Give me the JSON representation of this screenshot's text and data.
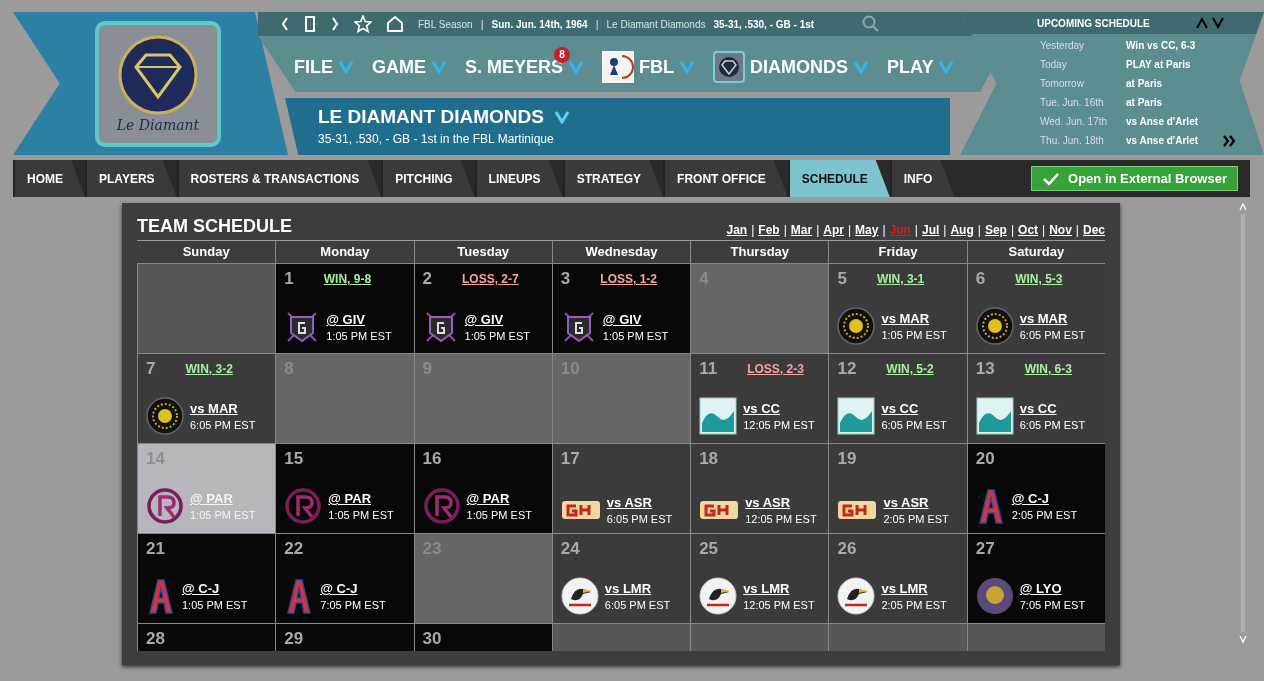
{
  "logo": {
    "caption": "Le Diamant"
  },
  "browser_bar": {
    "season": "FBL Season",
    "separator": "|",
    "date": "Sun. Jun. 14th, 1964",
    "team": "Le Diamant Diamonds",
    "record": "35-31, .530, - GB - 1st"
  },
  "menu": [
    {
      "label": "FILE"
    },
    {
      "label": "GAME"
    },
    {
      "label": "S. MEYERS",
      "badge": "8"
    },
    {
      "label": "FBL",
      "icon": {
        "kind": "league"
      }
    },
    {
      "label": "DIAMONDS",
      "icon": {
        "kind": "team"
      }
    },
    {
      "label": "PLAY"
    }
  ],
  "team_bar": {
    "name": "LE DIAMANT DIAMONDS",
    "subtitle": "35-31, .530, - GB - 1st in the FBL Martinique"
  },
  "upcoming": {
    "title": "UPCOMING SCHEDULE",
    "rows": [
      {
        "when": "Yesterday",
        "what": "Win vs CC, 6-3"
      },
      {
        "when": "Today",
        "what": "PLAY at Paris"
      },
      {
        "when": "Tomorrow",
        "what": "at Paris"
      },
      {
        "when": "Tue. Jun. 16th",
        "what": "at Paris"
      },
      {
        "when": "Wed. Jun. 17th",
        "what": "vs Anse d'Arlet"
      },
      {
        "when": "Thu. Jun. 18th",
        "what": "vs Anse d'Arlet"
      }
    ]
  },
  "tabs": [
    {
      "label": "HOME",
      "selected": false
    },
    {
      "label": "PLAYERS",
      "selected": false
    },
    {
      "label": "ROSTERS & TRANSACTIONS",
      "selected": false
    },
    {
      "label": "PITCHING",
      "selected": false
    },
    {
      "label": "LINEUPS",
      "selected": false
    },
    {
      "label": "STRATEGY",
      "selected": false
    },
    {
      "label": "FRONT OFFICE",
      "selected": false
    },
    {
      "label": "SCHEDULE",
      "selected": true
    },
    {
      "label": "INFO",
      "selected": false
    }
  ],
  "external_button": "Open in External Browser",
  "schedule": {
    "title": "TEAM SCHEDULE",
    "separator": "|",
    "months": [
      {
        "label": "Jan",
        "selected": false
      },
      {
        "label": "Feb",
        "selected": false
      },
      {
        "label": "Mar",
        "selected": false
      },
      {
        "label": "Apr",
        "selected": false
      },
      {
        "label": "May",
        "selected": false
      },
      {
        "label": "Jun",
        "selected": true
      },
      {
        "label": "Jul",
        "selected": false
      },
      {
        "label": "Aug",
        "selected": false
      },
      {
        "label": "Sep",
        "selected": false
      },
      {
        "label": "Oct",
        "selected": false
      },
      {
        "label": "Nov",
        "selected": false
      },
      {
        "label": "Dec",
        "selected": false
      }
    ],
    "weekdays": [
      "Sunday",
      "Monday",
      "Tuesday",
      "Wednesday",
      "Thursday",
      "Friday",
      "Saturday"
    ],
    "weeks": [
      [
        {
          "kind": "blank"
        },
        {
          "kind": "away",
          "day": "1",
          "result": "WIN, 9-8",
          "win": true,
          "logo": {
            "kind": "shield"
          },
          "matchup": "@ GIV",
          "time": "1:05 PM EST"
        },
        {
          "kind": "away",
          "day": "2",
          "result": "LOSS, 2-7",
          "win": false,
          "logo": {
            "kind": "shield"
          },
          "matchup": "@ GIV",
          "time": "1:05 PM EST"
        },
        {
          "kind": "away",
          "day": "3",
          "result": "LOSS, 1-2",
          "win": false,
          "logo": {
            "kind": "shield"
          },
          "matchup": "@ GIV",
          "time": "1:05 PM EST"
        },
        {
          "kind": "off",
          "day": "4"
        },
        {
          "kind": "home",
          "day": "5",
          "result": "WIN, 3-1",
          "win": true,
          "logo": {
            "kind": "sun"
          },
          "matchup": "vs MAR",
          "time": "1:05 PM EST"
        },
        {
          "kind": "home",
          "day": "6",
          "result": "WIN, 5-3",
          "win": true,
          "logo": {
            "kind": "sun"
          },
          "matchup": "vs MAR",
          "time": "6:05 PM EST"
        }
      ],
      [
        {
          "kind": "home",
          "day": "7",
          "result": "WIN, 3-2",
          "win": true,
          "logo": {
            "kind": "sun"
          },
          "matchup": "vs MAR",
          "time": "6:05 PM EST"
        },
        {
          "kind": "off",
          "day": "8"
        },
        {
          "kind": "off",
          "day": "9"
        },
        {
          "kind": "off",
          "day": "10"
        },
        {
          "kind": "home",
          "day": "11",
          "result": "LOSS, 2-3",
          "win": false,
          "logo": {
            "kind": "wave"
          },
          "matchup": "vs CC",
          "time": "12:05 PM EST"
        },
        {
          "kind": "home",
          "day": "12",
          "result": "WIN, 5-2",
          "win": true,
          "logo": {
            "kind": "wave"
          },
          "matchup": "vs CC",
          "time": "6:05 PM EST"
        },
        {
          "kind": "home",
          "day": "13",
          "result": "WIN, 6-3",
          "win": true,
          "logo": {
            "kind": "wave"
          },
          "matchup": "vs CC",
          "time": "6:05 PM EST"
        }
      ],
      [
        {
          "kind": "today",
          "day": "14",
          "logo": {
            "kind": "ring"
          },
          "matchup": "@ PAR",
          "time": "1:05 PM EST"
        },
        {
          "kind": "away",
          "day": "15",
          "logo": {
            "kind": "ring"
          },
          "matchup": "@ PAR",
          "time": "1:05 PM EST"
        },
        {
          "kind": "away",
          "day": "16",
          "logo": {
            "kind": "ring"
          },
          "matchup": "@ PAR",
          "time": "1:05 PM EST"
        },
        {
          "kind": "home",
          "day": "17",
          "logo": {
            "kind": "letters"
          },
          "matchup": "vs ASR",
          "time": "6:05 PM EST"
        },
        {
          "kind": "home",
          "day": "18",
          "logo": {
            "kind": "letters"
          },
          "matchup": "vs ASR",
          "time": "12:05 PM EST"
        },
        {
          "kind": "home",
          "day": "19",
          "logo": {
            "kind": "letters"
          },
          "matchup": "vs ASR",
          "time": "2:05 PM EST"
        },
        {
          "kind": "away",
          "day": "20",
          "logo": {
            "kind": "letter"
          },
          "matchup": "@ C-J",
          "time": "2:05 PM EST"
        }
      ],
      [
        {
          "kind": "away",
          "day": "21",
          "logo": {
            "kind": "letter"
          },
          "matchup": "@ C-J",
          "time": "1:05 PM EST"
        },
        {
          "kind": "away",
          "day": "22",
          "logo": {
            "kind": "letter"
          },
          "matchup": "@ C-J",
          "time": "7:05 PM EST"
        },
        {
          "kind": "off",
          "day": "23"
        },
        {
          "kind": "home",
          "day": "24",
          "logo": {
            "kind": "bird"
          },
          "matchup": "vs LMR",
          "time": "6:05 PM EST"
        },
        {
          "kind": "home",
          "day": "25",
          "logo": {
            "kind": "bird"
          },
          "matchup": "vs LMR",
          "time": "12:05 PM EST"
        },
        {
          "kind": "home",
          "day": "26",
          "logo": {
            "kind": "bird"
          },
          "matchup": "vs LMR",
          "time": "2:05 PM EST"
        },
        {
          "kind": "away",
          "day": "27",
          "logo": {
            "kind": "planet"
          },
          "matchup": "@ LYO",
          "time": "7:05 PM EST"
        }
      ],
      [
        {
          "kind": "away",
          "day": "28"
        },
        {
          "kind": "away",
          "day": "29"
        },
        {
          "kind": "away",
          "day": "30"
        },
        {
          "kind": "blank"
        },
        {
          "kind": "blank"
        },
        {
          "kind": "blank"
        },
        {
          "kind": "blank"
        }
      ]
    ]
  }
}
